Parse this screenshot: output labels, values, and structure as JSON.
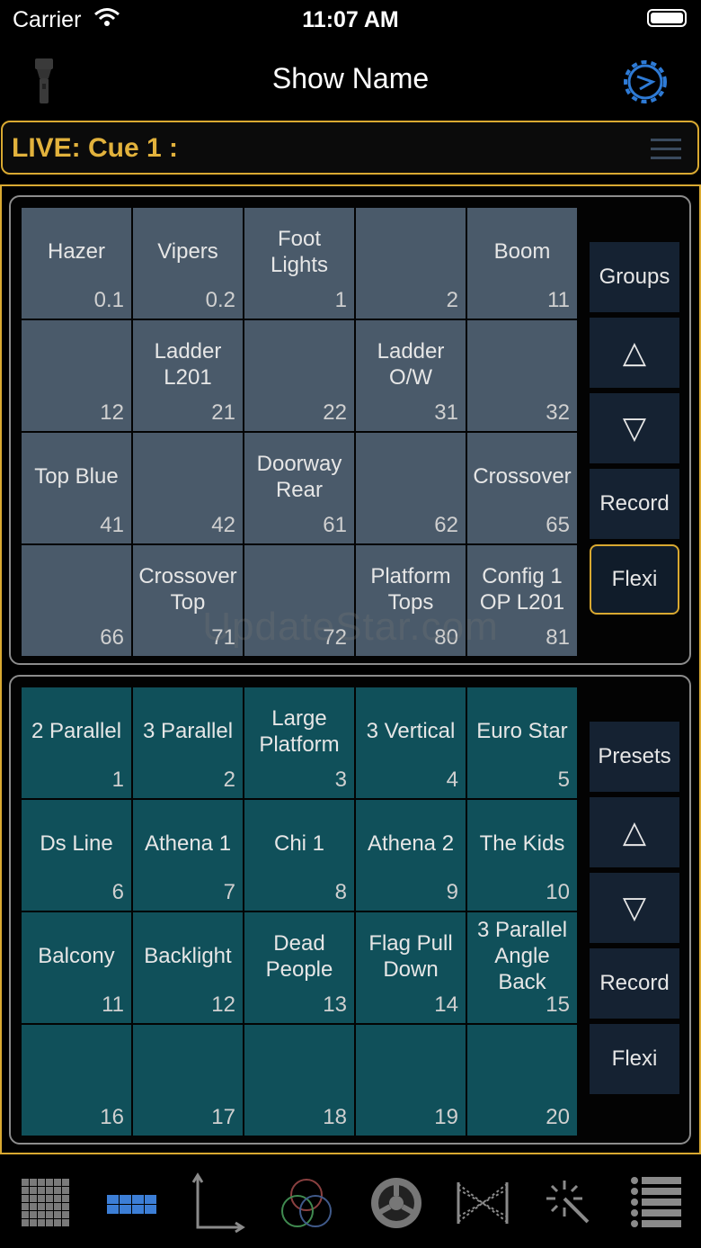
{
  "status_bar": {
    "carrier": "Carrier",
    "time": "11:07 AM"
  },
  "nav": {
    "title": "Show Name"
  },
  "live_bar": {
    "text": "LIVE: Cue  1 :"
  },
  "groups": {
    "tiles": [
      {
        "name": "Hazer",
        "num": "0.1"
      },
      {
        "name": "Vipers",
        "num": "0.2"
      },
      {
        "name": "Foot\nLights",
        "num": "1"
      },
      {
        "name": "",
        "num": "2"
      },
      {
        "name": "Boom",
        "num": "11"
      },
      {
        "name": "",
        "num": "12"
      },
      {
        "name": "Ladder\nL201",
        "num": "21"
      },
      {
        "name": "",
        "num": "22"
      },
      {
        "name": "Ladder\nO/W",
        "num": "31"
      },
      {
        "name": "",
        "num": "32"
      },
      {
        "name": "Top Blue",
        "num": "41"
      },
      {
        "name": "",
        "num": "42"
      },
      {
        "name": "Doorway\nRear",
        "num": "61"
      },
      {
        "name": "",
        "num": "62"
      },
      {
        "name": "Crossover",
        "num": "65"
      },
      {
        "name": "",
        "num": "66"
      },
      {
        "name": "Crossover\nTop",
        "num": "71"
      },
      {
        "name": "",
        "num": "72"
      },
      {
        "name": "Platform\nTops",
        "num": "80"
      },
      {
        "name": "Config 1\nOP L201",
        "num": "81"
      }
    ],
    "side": {
      "title": "Groups",
      "up": "△",
      "down": "▽",
      "record": "Record",
      "flexi": "Flexi"
    }
  },
  "presets": {
    "tiles": [
      {
        "name": "2 Parallel",
        "num": "1"
      },
      {
        "name": "3 Parallel",
        "num": "2"
      },
      {
        "name": "Large\nPlatform",
        "num": "3"
      },
      {
        "name": "3 Vertical",
        "num": "4"
      },
      {
        "name": "Euro Star",
        "num": "5"
      },
      {
        "name": "Ds Line",
        "num": "6"
      },
      {
        "name": "Athena 1",
        "num": "7"
      },
      {
        "name": "Chi 1",
        "num": "8"
      },
      {
        "name": "Athena 2",
        "num": "9"
      },
      {
        "name": "The Kids",
        "num": "10"
      },
      {
        "name": "Balcony",
        "num": "11"
      },
      {
        "name": "Backlight",
        "num": "12"
      },
      {
        "name": "Dead\nPeople",
        "num": "13"
      },
      {
        "name": "Flag Pull\nDown",
        "num": "14"
      },
      {
        "name": "3 Parallel\nAngle\nBack",
        "num": "15"
      },
      {
        "name": "",
        "num": "16"
      },
      {
        "name": "",
        "num": "17"
      },
      {
        "name": "",
        "num": "18"
      },
      {
        "name": "",
        "num": "19"
      },
      {
        "name": "",
        "num": "20"
      }
    ],
    "side": {
      "title": "Presets",
      "up": "△",
      "down": "▽",
      "record": "Record",
      "flexi": "Flexi"
    }
  },
  "watermark": "UpdateStar.com",
  "tabbar": {
    "items": [
      {
        "icon": "channel-grid-icon"
      },
      {
        "icon": "palette-tiles-icon",
        "active": true
      },
      {
        "icon": "axes-icon"
      },
      {
        "icon": "color-mix-icon"
      },
      {
        "icon": "gobo-wheel-icon"
      },
      {
        "icon": "crossfade-icon"
      },
      {
        "icon": "effects-wand-icon"
      },
      {
        "icon": "cue-list-icon"
      }
    ]
  },
  "colors": {
    "accent": "#d9a931",
    "group_tile": "#4a5a6a",
    "preset_tile": "#10505a",
    "side_button": "#152232"
  }
}
